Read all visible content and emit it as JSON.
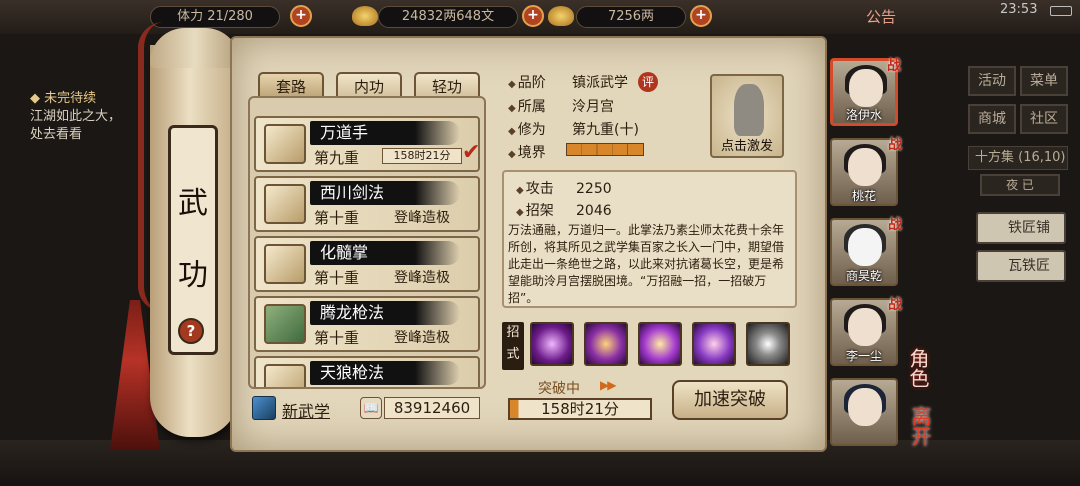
{
  "topbar": {
    "stamina": "体力 21/280",
    "silver": "24832两648文",
    "gold": "7256两",
    "notice": "公告",
    "time": "23:53"
  },
  "quest": {
    "title": "◆ 未完待续",
    "line1": "江湖如此之大，",
    "line2": "处去看看"
  },
  "scroll": {
    "title_char1": "武",
    "title_char2": "功",
    "help": "?"
  },
  "tabs": [
    "套路",
    "内功",
    "轻功"
  ],
  "skills": [
    {
      "name": "万道手",
      "level": "第九重",
      "status": "158时21分",
      "selected": true
    },
    {
      "name": "西川剑法",
      "level": "第十重",
      "status": "登峰造极"
    },
    {
      "name": "化髓掌",
      "level": "第十重",
      "status": "登峰造极"
    },
    {
      "name": "腾龙枪法",
      "level": "第十重",
      "status": "登峰造极"
    },
    {
      "name": "天狼枪法",
      "level": "",
      "status": ""
    }
  ],
  "bottom": {
    "new_skill": "新武学",
    "coins": "83912460"
  },
  "detail": {
    "grade_label": "品阶",
    "grade": "镇派武学",
    "eval_badge": "评",
    "sect_label": "所属",
    "sect": "泠月宫",
    "cultivation_label": "修为",
    "cultivation": "第九重(十)",
    "realm_label": "境界",
    "realm_progress": 1.0,
    "activate": "点击激发",
    "attack_label": "攻击",
    "attack": "2250",
    "parry_label": "招架",
    "parry": "2046",
    "description": "万法通融，万道归一。此掌法乃素尘师太花费十余年所创，将其所见之武学集百家之长入一门中，期望借此走出一条绝世之路，以此来对抗诸葛长空，更是希望能助泠月宫摆脱困境。“万招融一招，一招破万招”。",
    "moves_label": "招式",
    "break_label": "突破中",
    "break_timer": "158时21分",
    "speed_btn": "加速突破"
  },
  "characters": [
    {
      "name": "洛伊水",
      "tag": "战",
      "selected": true
    },
    {
      "name": "桃花",
      "tag": "战"
    },
    {
      "name": "商昊乾",
      "tag": "战"
    },
    {
      "name": "李一尘",
      "tag": "战"
    },
    {
      "name": ""
    }
  ],
  "side": {
    "role": "角色",
    "leave": "离开"
  },
  "rightmenu": {
    "activity": "活动",
    "menu": "菜单",
    "shop": "商城",
    "community": "社区",
    "map": "十方集 (16,10)",
    "night": "夜 已",
    "blacksmith": "铁匠铺",
    "tiler": "瓦铁匠"
  },
  "colors": {
    "accent_red": "#b82a1c",
    "parchment": "#e2d6bb",
    "progress": "#d8862a"
  }
}
